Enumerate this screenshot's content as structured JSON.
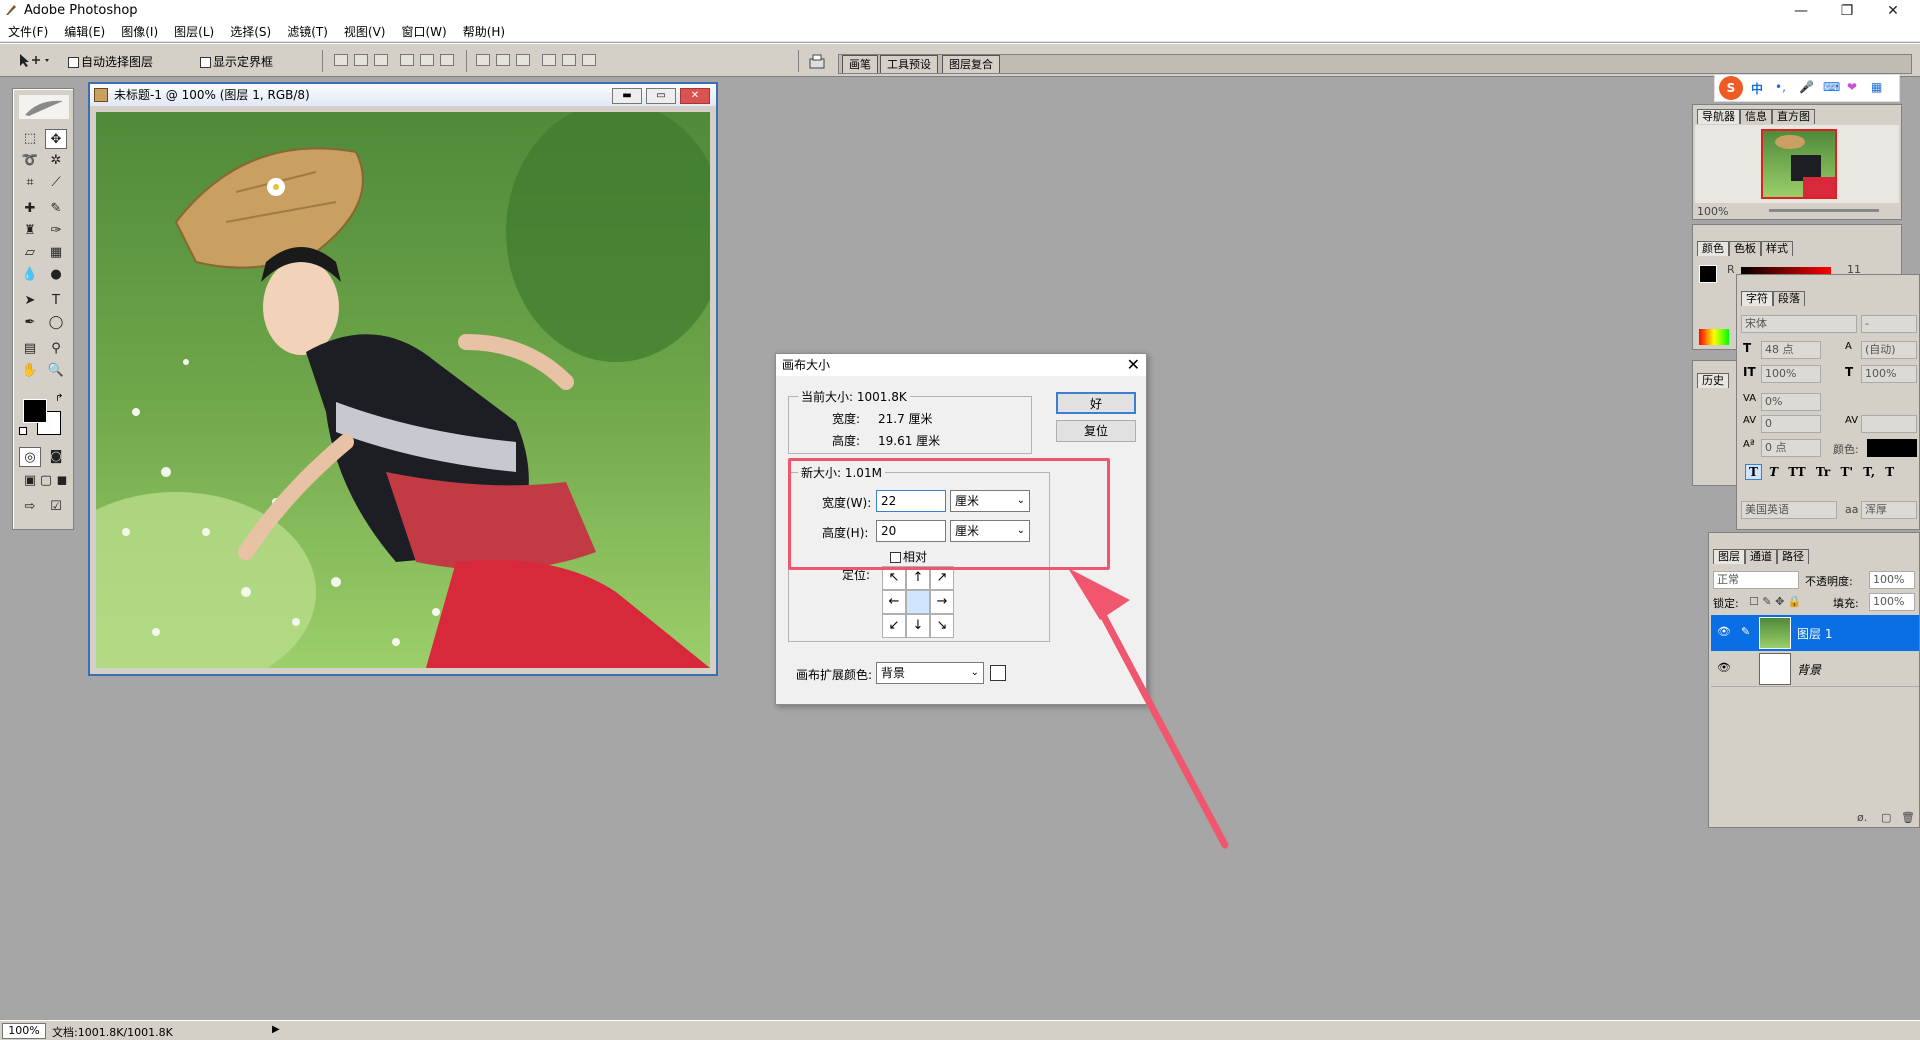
{
  "app": {
    "title": "Adobe Photoshop"
  },
  "window_controls": {
    "minimize": "—",
    "restore": "❐",
    "close": "✕"
  },
  "menu": [
    "文件(F)",
    "编辑(E)",
    "图像(I)",
    "图层(L)",
    "选择(S)",
    "滤镜(T)",
    "视图(V)",
    "窗口(W)",
    "帮助(H)"
  ],
  "options_bar": {
    "auto_select_layer": "自动选择图层",
    "show_bounding_box": "显示定界框",
    "palette_tabs": [
      "画笔",
      "工具预设",
      "图层复合"
    ]
  },
  "document": {
    "title": "未标题-1 @ 100% (图层 1, RGB/8)"
  },
  "dialog": {
    "title": "画布大小",
    "current_size_label": "当前大小: 1001.8K",
    "width_label": "宽度:",
    "width_value": "21.7 厘米",
    "height_label": "高度:",
    "height_value": "19.61 厘米",
    "new_size_label": "新大小: 1.01M",
    "new_width_label": "宽度(W):",
    "new_width_value": "22",
    "new_height_label": "高度(H):",
    "new_height_value": "20",
    "unit": "厘米",
    "relative_label": "相对",
    "anchor_label": "定位:",
    "anchor_arrows": [
      "↖",
      "↑",
      "↗",
      "←",
      "",
      "→",
      "↙",
      "↓",
      "↘"
    ],
    "ok_button": "好",
    "reset_button": "复位",
    "extension_color_label": "画布扩展颜色:",
    "extension_color_value": "背景",
    "highlight_color": "#f0566e"
  },
  "navigator": {
    "tabs": [
      "导航器",
      "信息",
      "直方图"
    ],
    "zoom": "100%"
  },
  "color_panel": {
    "tabs": [
      "颜色",
      "色板",
      "样式"
    ],
    "r_label": "R",
    "r_value": "11"
  },
  "history_panel": {
    "tab": "历史"
  },
  "character_panel": {
    "tabs": [
      "字符",
      "段落"
    ],
    "font": "宋体",
    "font_style": "-",
    "size": "48 点",
    "leading": "(自动)",
    "vertical_scale": "100%",
    "horizontal_scale": "100%",
    "tracking_pct": "0%",
    "tracking": "0",
    "baseline": "0 点",
    "color_label": "颜色:",
    "style_buttons": [
      "T",
      "T",
      "TT",
      "Tr",
      "T'",
      "T,",
      "T"
    ],
    "language": "美国英语",
    "aa_label": "aa",
    "antialias": "浑厚"
  },
  "layers_panel": {
    "tabs": [
      "图层",
      "通道",
      "路径"
    ],
    "blend_mode": "正常",
    "opacity_label": "不透明度:",
    "opacity": "100%",
    "lock_label": "锁定:",
    "fill_label": "填充:",
    "fill": "100%",
    "layers": [
      {
        "name": "图层 1",
        "selected": true
      },
      {
        "name": "背景",
        "selected": false
      }
    ]
  },
  "ime": {
    "logo": "S",
    "mode": "中"
  },
  "status": {
    "zoom": "100%",
    "doc_info": "文档:1001.8K/1001.8K"
  }
}
